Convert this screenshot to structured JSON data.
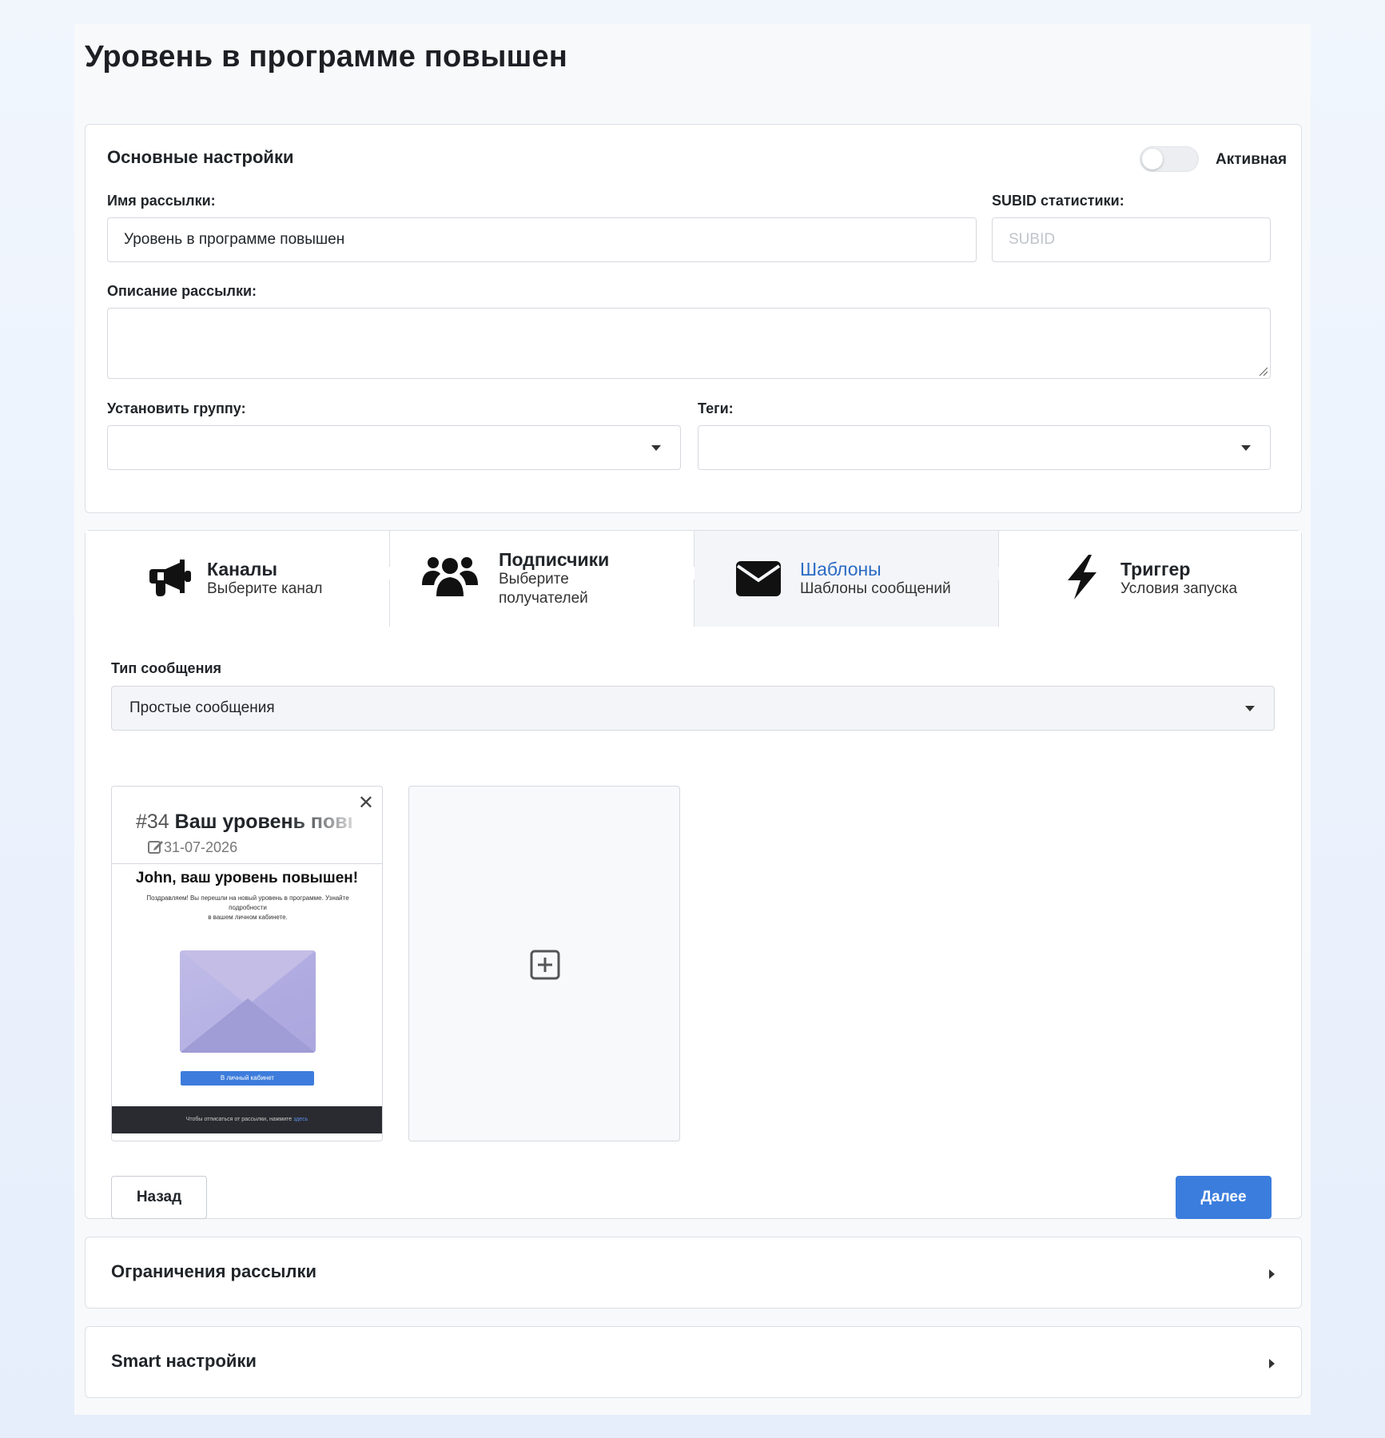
{
  "page": {
    "title": "Уровень в программе повышен"
  },
  "main": {
    "section_title": "Основные настройки",
    "active_label": "Активная",
    "active": false,
    "name_label": "Имя рассылки:",
    "name_value": "Уровень в программе повышен",
    "subid_label": "SUBID статистики:",
    "subid_placeholder": "SUBID",
    "description_label": "Описание рассылки:",
    "description_value": "",
    "group_label": "Установить группу:",
    "group_value": "",
    "tags_label": "Теги:",
    "tags_value": ""
  },
  "steps": [
    {
      "title": "Каналы",
      "subtitle": "Выберите канал",
      "icon": "bullhorn-icon",
      "active": false
    },
    {
      "title": "Подписчики",
      "subtitle": "Выберите получателей",
      "icon": "users-icon",
      "active": false
    },
    {
      "title": "Шаблоны",
      "subtitle": "Шаблоны сообщений",
      "icon": "envelope-icon",
      "active": true
    },
    {
      "title": "Триггер",
      "subtitle": "Условия запуска",
      "icon": "bolt-icon",
      "active": false
    }
  ],
  "templates": {
    "type_label": "Тип сообщения",
    "type_value": "Простые сообщения",
    "card": {
      "number": "#34",
      "title": "Ваш уровень повышен",
      "date": "31-07-2026",
      "preview_heading": "John, ваш уровень повышен!",
      "preview_body": "Поздравляем! Вы перешли на новый уровень в программе. Узнайте подробности",
      "preview_body_2": "в вашем личном кабинете.",
      "preview_button": "В личный кабинет",
      "preview_footer": "Чтобы отписаться от рассылки, нажмите",
      "preview_footer_link": "здесь"
    },
    "back_button": "Назад",
    "next_button": "Далее"
  },
  "limits": {
    "title": "Ограничения рассылки"
  },
  "smart": {
    "title": "Smart настройки"
  },
  "colors": {
    "accent": "#3b7ddd",
    "active_step_title": "#2c6bc4",
    "active_step_bg": "#f4f5f8"
  }
}
